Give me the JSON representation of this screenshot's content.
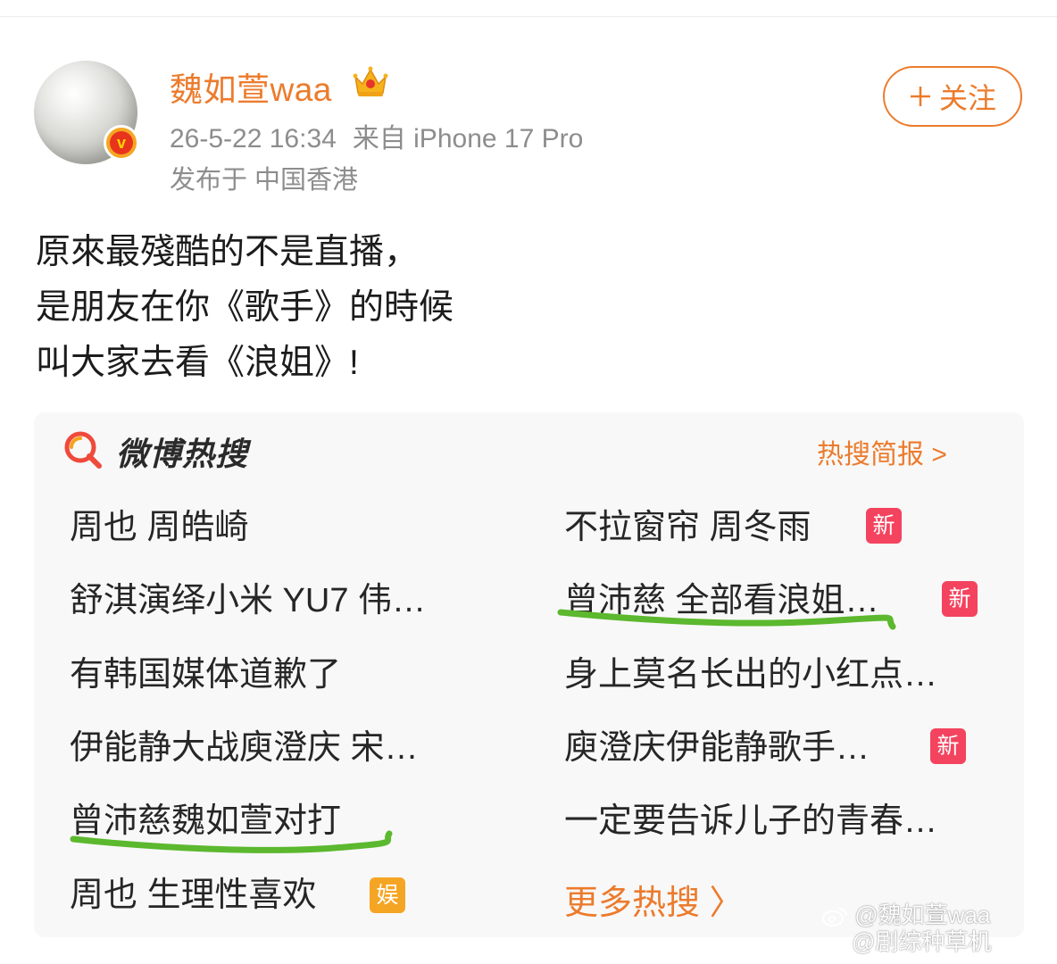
{
  "post": {
    "author": {
      "name": "魏如萱waa",
      "verified_icon": "verified-v-badge-icon",
      "vip_icon": "crown-icon"
    },
    "timestamp": "26-5-22 16:34",
    "source": "来自 iPhone 17 Pro",
    "location": "发布于 中国香港",
    "follow_label": "关注",
    "follow_icon": "plus-icon",
    "text_lines": [
      "原來最殘酷的不是直播，",
      "是朋友在你《歌手》的時候",
      "叫大家去看《浪姐》!"
    ]
  },
  "hot_search": {
    "title": "微博热搜",
    "logo_icon": "weibo-search-icon",
    "brief_label": "热搜简报 >",
    "left": [
      {
        "text": "周也 周皓崎",
        "tag": ""
      },
      {
        "text": "舒淇演绎小米 YU7 伟…",
        "tag": ""
      },
      {
        "text": "有韩国媒体道歉了",
        "tag": ""
      },
      {
        "text": "伊能静大战庾澄庆 宋…",
        "tag": ""
      },
      {
        "text": "曾沛慈魏如萱对打",
        "tag": "",
        "underlined": true
      },
      {
        "text": "周也 生理性喜欢",
        "tag": "娱"
      }
    ],
    "right": [
      {
        "text": "不拉窗帘 周冬雨",
        "tag": "新"
      },
      {
        "text": "曾沛慈 全部看浪姐…",
        "tag": "新",
        "underlined": true
      },
      {
        "text": "身上莫名长出的小红点…",
        "tag": ""
      },
      {
        "text": "庾澄庆伊能静歌手…",
        "tag": "新"
      },
      {
        "text": "一定要告诉儿子的青春…",
        "tag": ""
      }
    ],
    "more_label": "更多热搜 〉"
  },
  "colors": {
    "accent_orange": "#ec7b2c",
    "new_tag": "#f4435e",
    "ent_tag": "#f5a524",
    "highlight_green": "#5cb82e",
    "meta_gray": "#8d8d8d"
  },
  "watermark": {
    "line1": "@魏如萱waa",
    "line2": "@剧综种草机",
    "icon": "weibo-logo-icon"
  }
}
